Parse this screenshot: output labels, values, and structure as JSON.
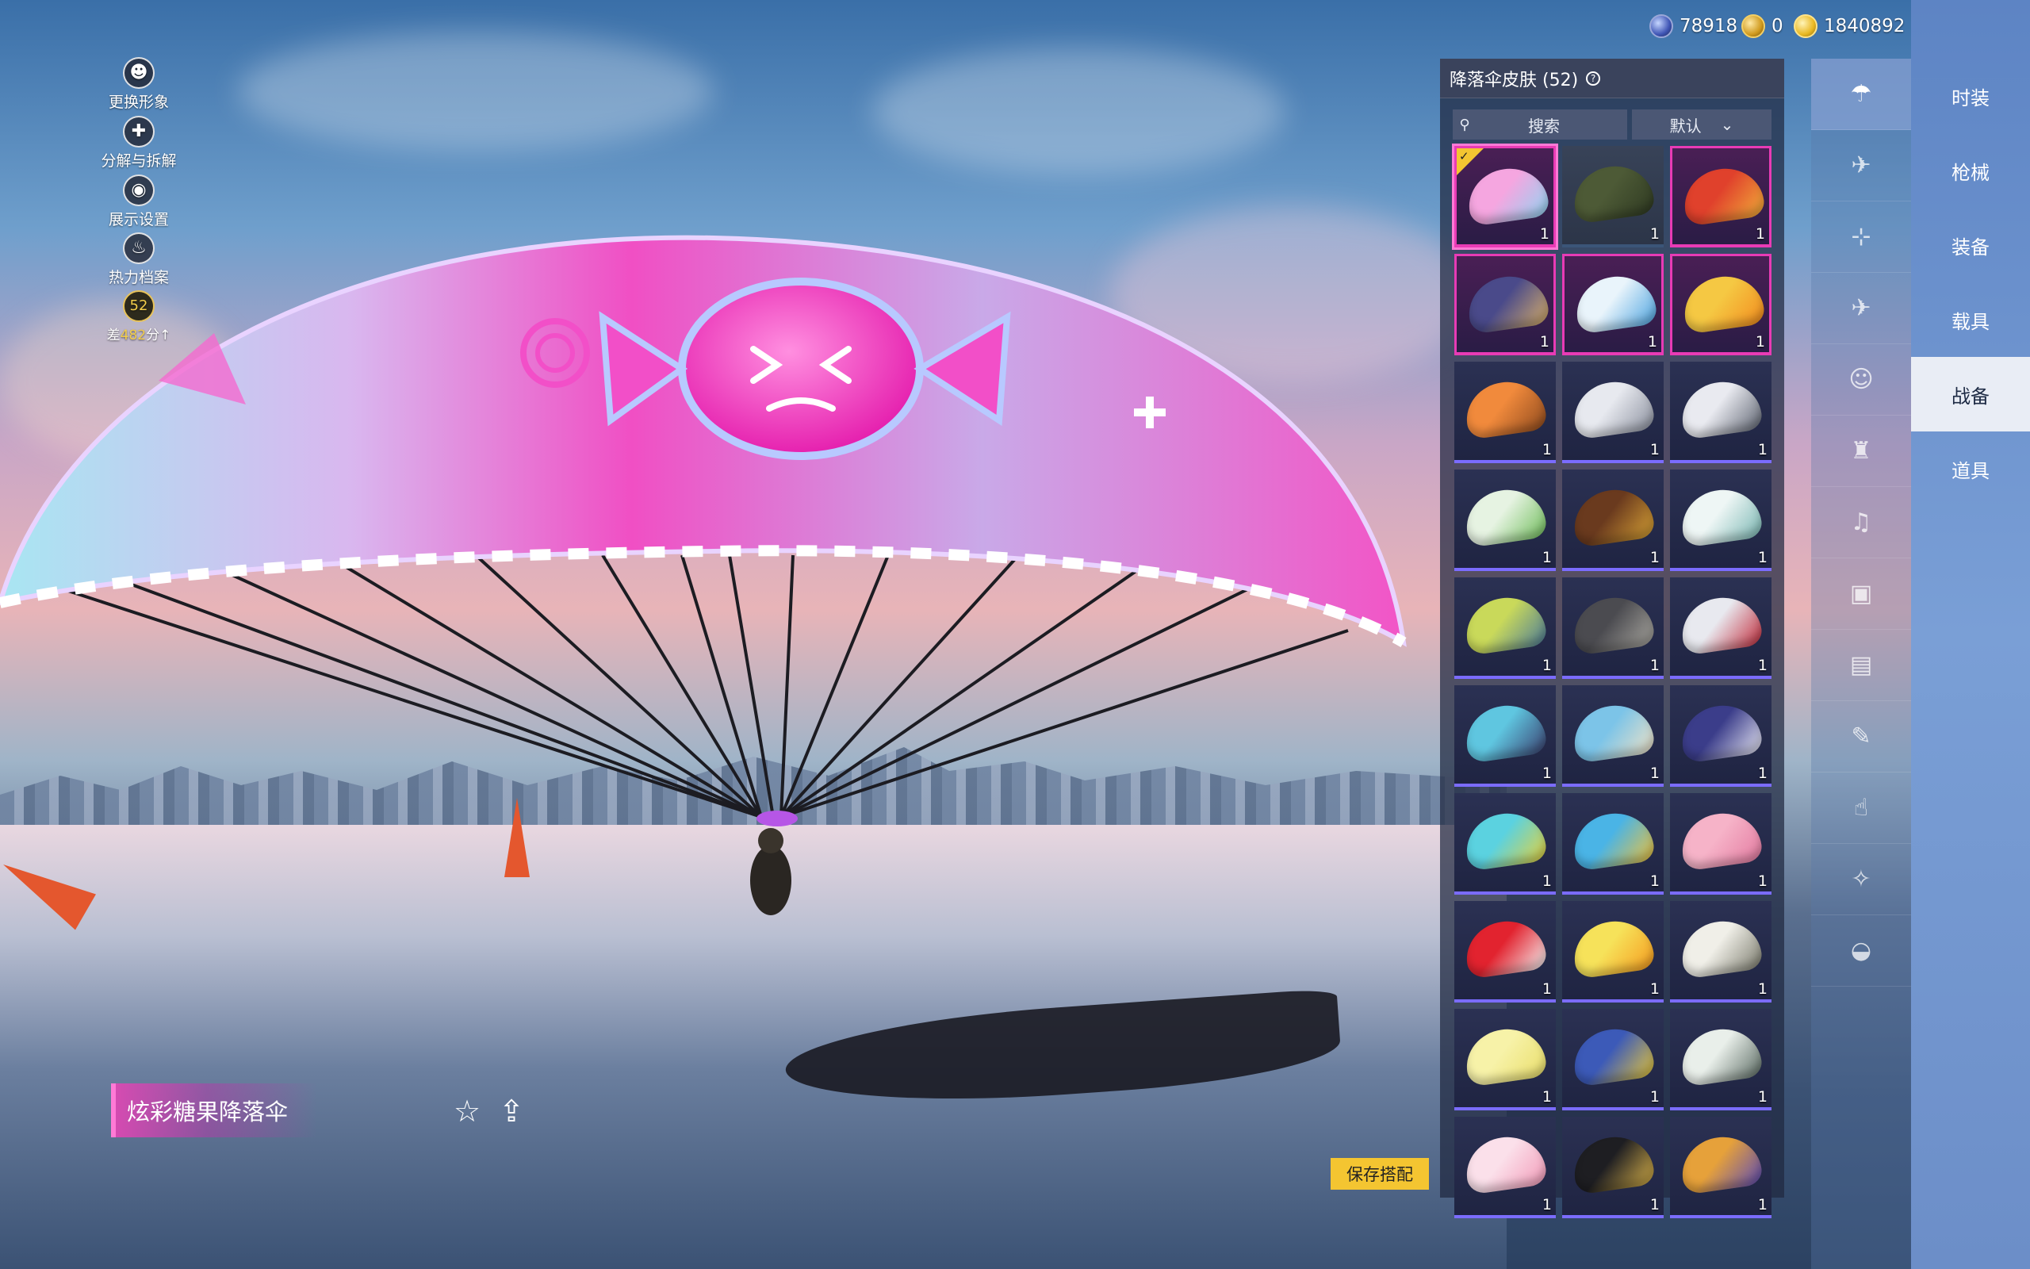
{
  "currency": [
    {
      "icon": "silver-coin-icon",
      "value": "78918"
    },
    {
      "icon": "gold-coin-icon",
      "value": "0"
    },
    {
      "icon": "uc-coin-icon",
      "value": "1840892"
    }
  ],
  "left_menu": [
    {
      "label": "更换形象",
      "icon": "avatar-icon",
      "glyph": "☻"
    },
    {
      "label": "分解与拆解",
      "icon": "puzzle-icon",
      "glyph": "✚"
    },
    {
      "label": "展示设置",
      "icon": "eye-icon",
      "glyph": "◉"
    },
    {
      "label": "热力档案",
      "icon": "flame-icon",
      "glyph": "♨"
    }
  ],
  "rank": {
    "prefix": "差",
    "value": "482",
    "suffix": "分",
    "arrow": "↑",
    "badge": "52"
  },
  "panel": {
    "title": "降落伞皮肤 (52)",
    "search_label": "搜索",
    "sort_label": "默认",
    "items": [
      {
        "count": "1",
        "rarity": "legend",
        "c1": "#f5a6e0",
        "c2": "#8fd4f2",
        "equipped": true
      },
      {
        "count": "1",
        "rarity": "plain",
        "c1": "#4d5a36",
        "c2": "#2f3a22"
      },
      {
        "count": "1",
        "rarity": "legend",
        "c1": "#e0412c",
        "c2": "#f2b13a"
      },
      {
        "count": "1",
        "rarity": "legend",
        "c1": "#4a4a8a",
        "c2": "#d9b06a"
      },
      {
        "count": "1",
        "rarity": "legend",
        "c1": "#e9f4fb",
        "c2": "#4ba3e0"
      },
      {
        "count": "1",
        "rarity": "legend",
        "c1": "#f5c843",
        "c2": "#f28b1e"
      },
      {
        "count": "1",
        "rarity": "epic",
        "c1": "#f18a3c",
        "c2": "#8e4a1e"
      },
      {
        "count": "1",
        "rarity": "epic",
        "c1": "#e7e9ef",
        "c2": "#8a8f9d"
      },
      {
        "count": "1",
        "rarity": "epic",
        "c1": "#e9eaf0",
        "c2": "#5d6370"
      },
      {
        "count": "1",
        "rarity": "epic",
        "c1": "#e6f3e2",
        "c2": "#6fbd5a"
      },
      {
        "count": "1",
        "rarity": "epic",
        "c1": "#6a3a1e",
        "c2": "#d9a336"
      },
      {
        "count": "1",
        "rarity": "epic",
        "c1": "#eef6f5",
        "c2": "#78b6b2"
      },
      {
        "count": "1",
        "rarity": "epic",
        "c1": "#c9d95a",
        "c2": "#4a7a9a"
      },
      {
        "count": "1",
        "rarity": "epic",
        "c1": "#4b4b50",
        "c2": "#a9a7a0"
      },
      {
        "count": "1",
        "rarity": "epic",
        "c1": "#e8e9ef",
        "c2": "#c22a3a"
      },
      {
        "count": "1",
        "rarity": "epic",
        "c1": "#5fc6e0",
        "c2": "#3b3f6e"
      },
      {
        "count": "1",
        "rarity": "epic",
        "c1": "#7cc4e8",
        "c2": "#f2e3c6"
      },
      {
        "count": "1",
        "rarity": "epic",
        "c1": "#3b3d8a",
        "c2": "#e9e9f5"
      },
      {
        "count": "1",
        "rarity": "epic",
        "c1": "#5bd2e0",
        "c2": "#e8d23a"
      },
      {
        "count": "1",
        "rarity": "epic",
        "c1": "#4ab4e6",
        "c2": "#f0c23a"
      },
      {
        "count": "1",
        "rarity": "epic",
        "c1": "#f6b3c8",
        "c2": "#e37aa0"
      },
      {
        "count": "1",
        "rarity": "epic",
        "c1": "#e2232f",
        "c2": "#f5f5f5"
      },
      {
        "count": "1",
        "rarity": "epic",
        "c1": "#f6e25a",
        "c2": "#f59a1e"
      },
      {
        "count": "1",
        "rarity": "epic",
        "c1": "#f0efe8",
        "c2": "#7a7a6c"
      },
      {
        "count": "1",
        "rarity": "epic",
        "c1": "#f7f2a8",
        "c2": "#e9de6a"
      },
      {
        "count": "1",
        "rarity": "epic",
        "c1": "#3c5ab8",
        "c2": "#e8c83a"
      },
      {
        "count": "1",
        "rarity": "epic",
        "c1": "#e9efea",
        "c2": "#5a6a62"
      },
      {
        "count": "1",
        "rarity": "epic",
        "c1": "#fbe0ea",
        "c2": "#f29ab8"
      },
      {
        "count": "1",
        "rarity": "epic",
        "c1": "#1e1e22",
        "c2": "#d9b24a"
      },
      {
        "count": "1",
        "rarity": "epic",
        "c1": "#e6a13a",
        "c2": "#5a4ab8"
      }
    ]
  },
  "categories": [
    {
      "icon": "parachute-icon",
      "glyph": "☂",
      "active": true
    },
    {
      "icon": "glider-icon",
      "glyph": "✈"
    },
    {
      "icon": "drone-icon",
      "glyph": "⊹"
    },
    {
      "icon": "plane-icon",
      "glyph": "✈"
    },
    {
      "icon": "face-icon",
      "glyph": "☺"
    },
    {
      "icon": "robot-icon",
      "glyph": "♜"
    },
    {
      "icon": "speaker-icon",
      "glyph": "♫"
    },
    {
      "icon": "chat-icon",
      "glyph": "▣"
    },
    {
      "icon": "gallery-icon",
      "glyph": "▤"
    },
    {
      "icon": "spray-icon",
      "glyph": "✎"
    },
    {
      "icon": "hand-icon",
      "glyph": "☝"
    },
    {
      "icon": "wand-icon",
      "glyph": "✧"
    },
    {
      "icon": "dish-icon",
      "glyph": "◒"
    }
  ],
  "tabs": [
    {
      "label": "时装",
      "active": false
    },
    {
      "label": "枪械",
      "active": false
    },
    {
      "label": "装备",
      "active": false
    },
    {
      "label": "载具",
      "active": false
    },
    {
      "label": "战备",
      "active": true
    },
    {
      "label": "道具",
      "active": false
    }
  ],
  "item_name": "炫彩糖果降落伞",
  "save_label": "保存搭配",
  "close_glyph": "✕",
  "star_glyph": "☆",
  "share_glyph": "⇪"
}
